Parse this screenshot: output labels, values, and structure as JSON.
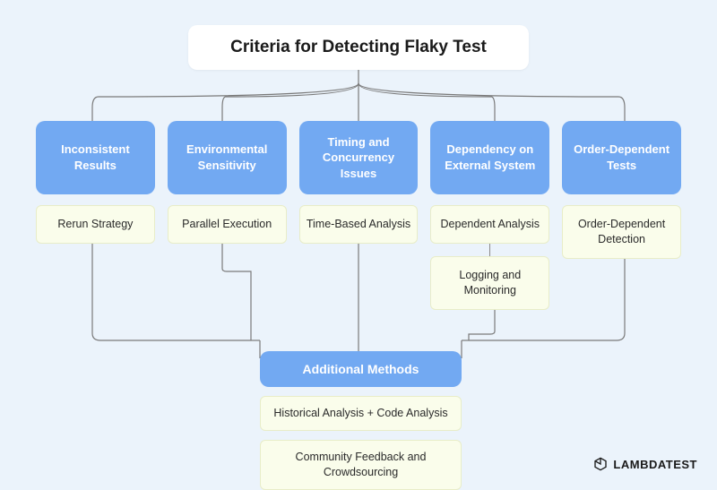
{
  "title": "Criteria for Detecting Flaky Test",
  "categories": [
    {
      "label": "Inconsistent Results",
      "methods": [
        "Rerun Strategy"
      ]
    },
    {
      "label": "Environmental Sensitivity",
      "methods": [
        "Parallel Execution"
      ]
    },
    {
      "label": "Timing and Concurrency Issues",
      "methods": [
        "Time-Based Analysis"
      ]
    },
    {
      "label": "Dependency on External System",
      "methods": [
        "Dependent Analysis",
        "Logging and Monitoring"
      ]
    },
    {
      "label": "Order-Dependent Tests",
      "methods": [
        "Order-Dependent Detection"
      ]
    }
  ],
  "additional": {
    "label": "Additional Methods",
    "methods": [
      "Historical Analysis + Code Analysis",
      "Community Feedback and Crowdsourcing"
    ]
  },
  "brand": "LAMBDATEST"
}
